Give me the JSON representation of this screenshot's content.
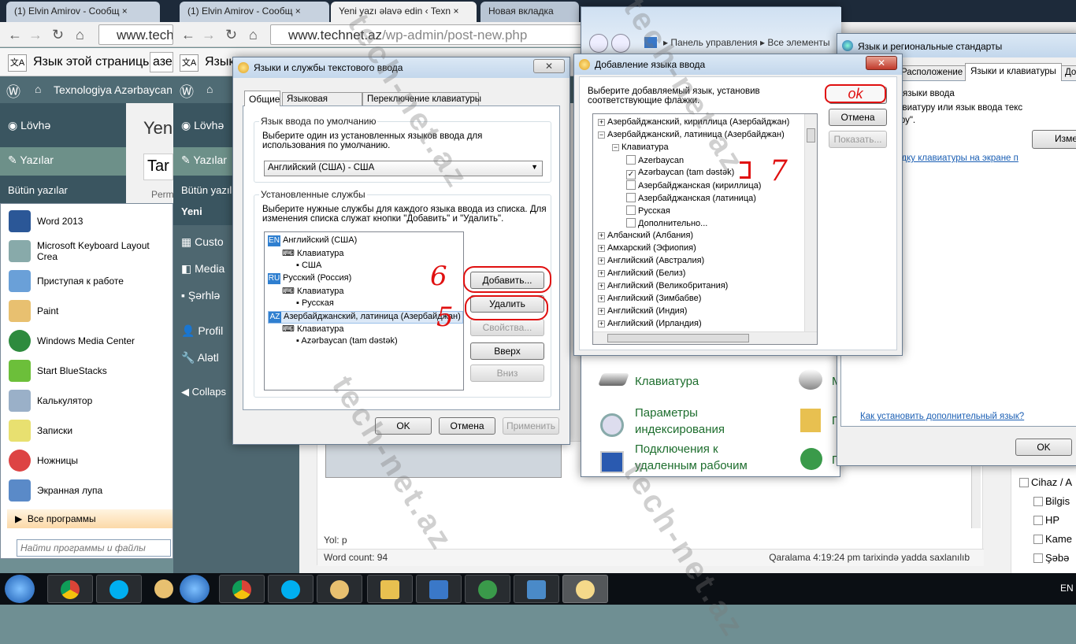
{
  "browser": {
    "tabs": [
      "(1) Elvin Amirov - Сообщ",
      "(1) Elvin Amirov - Сообщ",
      "Yeni yazı əlavə edin ‹ Texn",
      "Новая вкладка"
    ],
    "url_left": "www.techn",
    "url_host": "www.technet.az",
    "url_path": "/wp-admin/post-new.php",
    "translate_label": "Язык этой страницы",
    "translate_lang": "азе",
    "translate_label_short": "Язык"
  },
  "wp": {
    "site_name": "Texnologiya Azərbaycan v",
    "site_name_short": "T",
    "menu": [
      "Lövhə",
      "Yazılar",
      "Bütün yazılar",
      "Yeni",
      "Custo",
      "Media",
      "Şərhlə",
      "Profil",
      "Alətl",
      "Collaps"
    ],
    "page_title": "Yeni",
    "title_input": "Tar",
    "perm": "Perm",
    "path_label": "Yol: p",
    "word_count": "Word count: 94",
    "draft_saved": "Qaralama 4:19:24 pm tarixində yadda saxlanılıb",
    "categories": [
      "Cihaz / A",
      "Bilgis",
      "HP",
      "Kame",
      "Şəbə"
    ]
  },
  "start_menu": {
    "items": [
      "Word 2013",
      "Microsoft Keyboard Layout Crea",
      "Приступая к работе",
      "Paint",
      "Windows Media Center",
      "Start BlueStacks",
      "Калькулятор",
      "Записки",
      "Ножницы",
      "Экранная лупа"
    ],
    "all_programs": "Все программы",
    "search_placeholder": "Найти программы и файлы"
  },
  "text_services": {
    "title": "Языки и службы текстового ввода",
    "tabs": [
      "Общие",
      "Языковая панель",
      "Переключение клавиатуры"
    ],
    "default_group": "Язык ввода по умолчанию",
    "default_desc": "Выберите один из установленных языков ввода для использования по умолчанию.",
    "default_value": "Английский (США) - США",
    "installed_group": "Установленные службы",
    "installed_desc": "Выберите нужные службы для каждого языка ввода из списка. Для изменения списка служат кнопки \"Добавить\" и \"Удалить\".",
    "tree": [
      {
        "badge": "EN",
        "lang": "Английский (США)",
        "kb": "Клавиатура",
        "layout": "США"
      },
      {
        "badge": "RU",
        "lang": "Русский (Россия)",
        "kb": "Клавиатура",
        "layout": "Русская"
      },
      {
        "badge": "AZ",
        "lang": "Азербайджанский, латиница (Азербайджан)",
        "kb": "Клавиатура",
        "layout": "Azərbaycan (tam dəstək)"
      }
    ],
    "buttons": {
      "add": "Добавить...",
      "remove": "Удалить",
      "props": "Свойства...",
      "up": "Вверх",
      "down": "Вниз",
      "ok": "OK",
      "cancel": "Отмена",
      "apply": "Применить"
    },
    "annotations": [
      "6",
      "5"
    ]
  },
  "add_lang": {
    "title": "Добавление языка ввода",
    "desc": "Выберите добавляемый язык, установив соответствующие флажки.",
    "ok": "OK",
    "cancel": "Отмена",
    "show": "Показать...",
    "tree": [
      {
        "t": "Азербайджанский, кириллица (Азербайджан)",
        "lvl": 0,
        "pm": "+"
      },
      {
        "t": "Азербайджанский, латиница (Азербайджан)",
        "lvl": 0,
        "pm": "−"
      },
      {
        "t": "Клавиатура",
        "lvl": 1,
        "pm": "−"
      },
      {
        "t": "Azerbaycan",
        "lvl": 2,
        "cb": ""
      },
      {
        "t": "Azərbaycan (tam dəstək)",
        "lvl": 2,
        "cb": "✓"
      },
      {
        "t": "Азербайджанская (кириллица)",
        "lvl": 2,
        "cb": ""
      },
      {
        "t": "Азербайджанская (латиница)",
        "lvl": 2,
        "cb": ""
      },
      {
        "t": "Русская",
        "lvl": 2,
        "cb": ""
      },
      {
        "t": "Дополнительно...",
        "lvl": 2,
        "cb": ""
      },
      {
        "t": "Албанский (Албания)",
        "lvl": 0,
        "pm": "+"
      },
      {
        "t": "Амхарский (Эфиопия)",
        "lvl": 0,
        "pm": "+"
      },
      {
        "t": "Английский (Австралия)",
        "lvl": 0,
        "pm": "+"
      },
      {
        "t": "Английский (Белиз)",
        "lvl": 0,
        "pm": "+"
      },
      {
        "t": "Английский (Великобритания)",
        "lvl": 0,
        "pm": "+"
      },
      {
        "t": "Английский (Зимбабве)",
        "lvl": 0,
        "pm": "+"
      },
      {
        "t": "Английский (Индия)",
        "lvl": 0,
        "pm": "+"
      },
      {
        "t": "Английский (Ирландия)",
        "lvl": 0,
        "pm": "+"
      }
    ],
    "annotations": [
      "ok",
      "7"
    ]
  },
  "control_panel": {
    "breadcrumb": [
      "Панель управления",
      "Все элементы"
    ],
    "items": [
      "Клавиатура",
      "Параметры индексирования",
      "Подключения к удаленным рабочим"
    ],
    "right_initials": [
      "М",
      "П",
      "П"
    ]
  },
  "regional": {
    "title": "Язык и региональные стандарты",
    "tabs": [
      "Расположение",
      "Языки и клавиатуры",
      "Доп"
    ],
    "group": "уры и другие языки ввода",
    "desc": "изменить клавиатуру или язык ввода текс",
    "desc2": "ить клавиатуру\".",
    "change_btn": "Изме",
    "link1": "енить раскладку клавиатуры на экране п",
    "link2": "Как установить дополнительный язык?",
    "ok": "OK"
  },
  "taskbar": {
    "lang": "EN"
  },
  "watermark": "tech-net.az",
  "colors": {
    "accent": "#e01010",
    "link": "#1b5fb4",
    "wp_sidebar": "#3a5560"
  }
}
